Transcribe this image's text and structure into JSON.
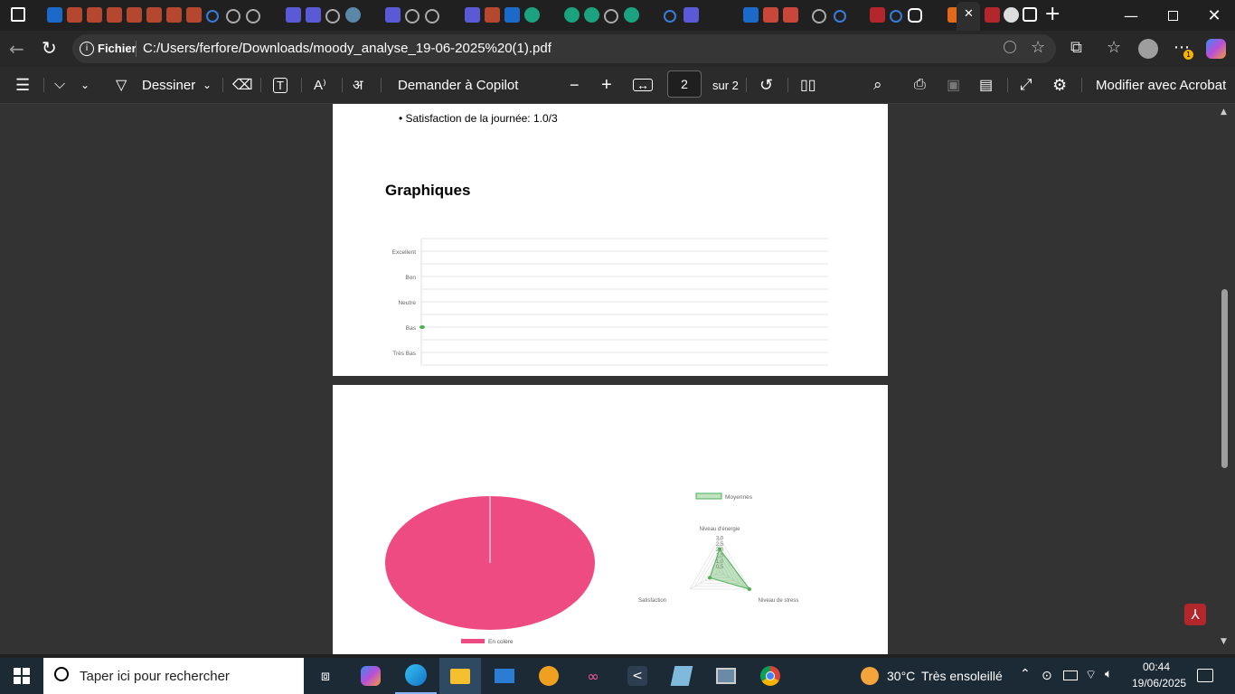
{
  "browser": {
    "close_tab_symbol": "✕",
    "address_label": "Fichier",
    "url": "C:/Users/ferfore/Downloads/moody_analyse_19-06-2025%20(1).pdf",
    "extension_badge": "1"
  },
  "toolbar": {
    "draw_label": "Dessiner",
    "copilot_label": "Demander à Copilot",
    "page_input_value": "2",
    "page_total": "sur 2",
    "acrobat_label": "Modifier avec Acrobat"
  },
  "page1": {
    "bullet_text": "• Satisfaction de la journée: 1.0/3",
    "section_title": "Graphiques"
  },
  "chart_data": [
    {
      "type": "line",
      "title": "",
      "y_categories": [
        "Excellent",
        "Bon",
        "Neutre",
        "Bas",
        "Très Bas"
      ],
      "x": [
        ""
      ],
      "series": [
        {
          "name": "",
          "values": [
            "Bas"
          ],
          "color": "#4caf50"
        }
      ]
    },
    {
      "type": "pie",
      "labels": [
        "En colère"
      ],
      "values": [
        100
      ],
      "colors": [
        "#ee4b82"
      ],
      "legend": "bottom"
    },
    {
      "type": "radar",
      "axes": [
        "Niveau d'énergie",
        "Niveau de stress",
        "Satisfaction"
      ],
      "ticks": [
        "3,0",
        "2,5",
        "2,0",
        "1,5",
        "1,0",
        "0,5"
      ],
      "rmax": 3,
      "series": [
        {
          "name": "Moyennes",
          "values": [
            2.0,
            3.0,
            1.0
          ],
          "color": "#4caf50"
        }
      ],
      "legend": "top"
    }
  ],
  "taskbar": {
    "search_placeholder": "Taper ici pour rechercher",
    "weather_temp": "30°C",
    "weather_text": "Très ensoleillé",
    "time": "00:44",
    "date": "19/06/2025"
  }
}
